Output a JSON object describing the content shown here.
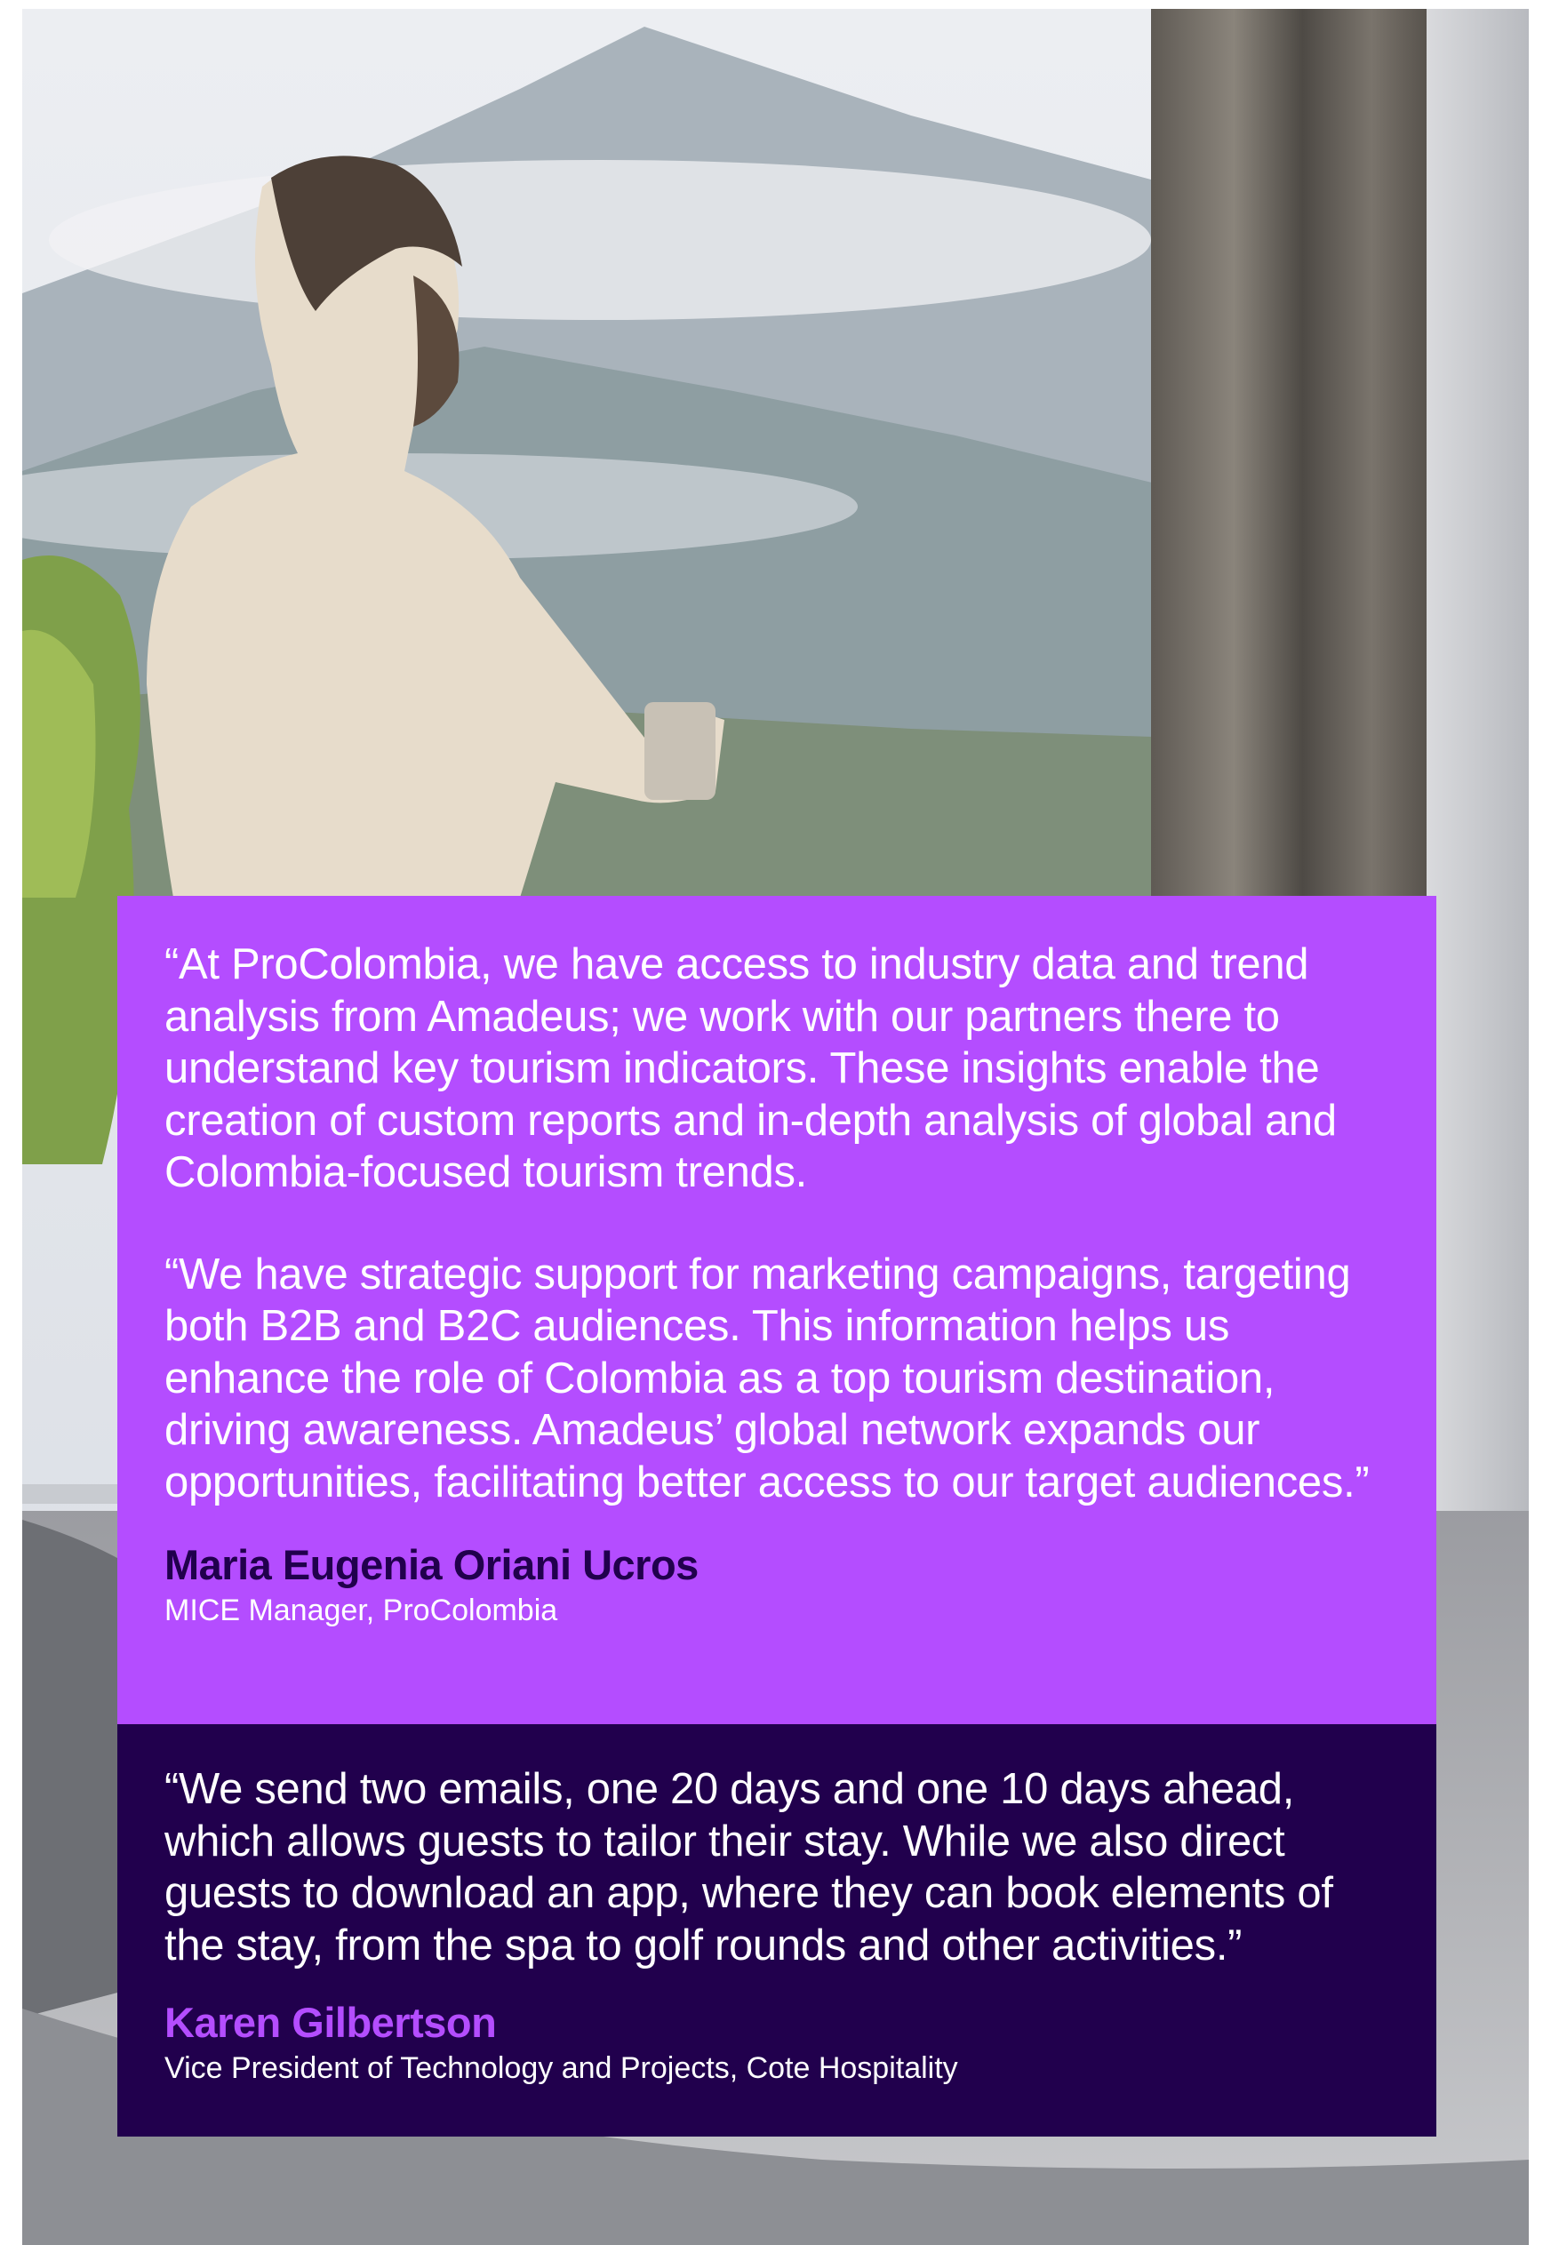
{
  "quotes": [
    {
      "paragraphs": [
        "“At ProColombia, we have access to industry data and trend analysis from Amadeus; we work with our partners there to understand key tourism indicators. These insights enable the creation of custom reports and in-depth analysis of global and Colombia-focused tourism trends.",
        "“We have strategic support for marketing campaigns, targeting both B2B and B2C audiences. This information helps us enhance the role of Colombia as a top tourism destination, driving awareness. Amadeus’ global network expands our opportunities, facilitating better access to our target audiences.”"
      ],
      "author": "Maria Eugenia Oriani Ucros",
      "title": "MICE Manager, ProColombia"
    },
    {
      "paragraphs": [
        "“We send two emails, one 20 days and one 10 days ahead, which allows guests to tailor their stay. While we also direct guests to download an app, where they can book elements of the stay, from the spa to golf rounds and other activities.”"
      ],
      "author": "Karen Gilbertson",
      "title": "Vice President of Technology and Projects, Cote Hospitality"
    }
  ],
  "colors": {
    "purple": "#b44dff",
    "dark_purple": "#21004d",
    "text_white": "#ffffff"
  }
}
